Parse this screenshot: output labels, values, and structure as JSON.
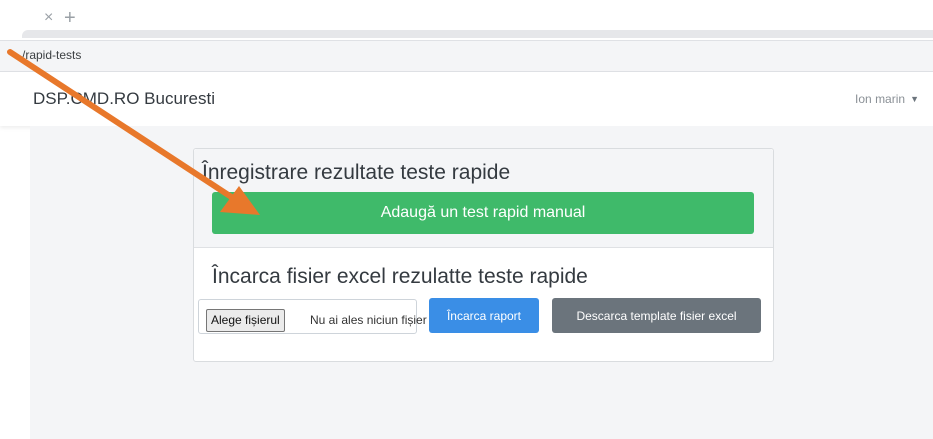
{
  "browser": {
    "tab_close_glyph": "×",
    "new_tab_glyph": "+",
    "url": "/rapid-tests"
  },
  "navbar": {
    "brand": "DSP.CMD.RO Bucuresti",
    "user": "Ion marin",
    "caret_glyph": "▼"
  },
  "card": {
    "title": "Înregistrare rezultate teste rapide",
    "add_button": "Adaugă un test rapid manual",
    "upload_title": "Încarca fisier excel rezulatte teste rapide",
    "file_button": "Alege fișierul",
    "file_status": "Nu ai ales niciun fișier",
    "upload_button": "Încarca raport",
    "template_button": "Descarca template fisier excel"
  },
  "colors": {
    "success": "#3fba6a",
    "primary": "#3a8ee6",
    "secondary": "#6b747c",
    "annotation_arrow": "#e8782b"
  },
  "annotation": {
    "icon": "arrow-annotation-icon"
  }
}
